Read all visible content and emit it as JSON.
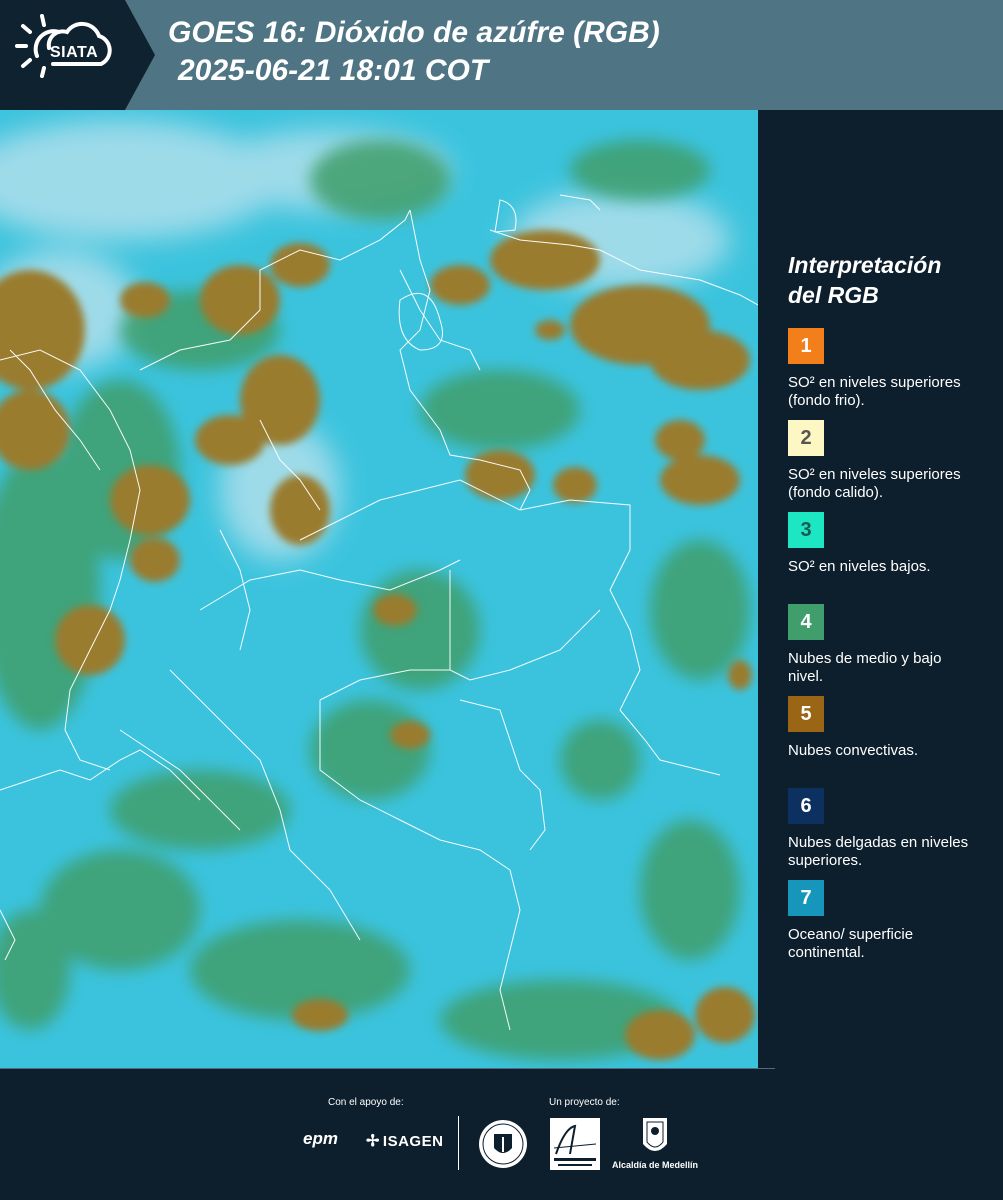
{
  "header": {
    "logo_text": "SIATA",
    "title_line1": "GOES 16: Dióxido de azúfre (RGB)",
    "title_line2": "2025-06-21 18:01 COT"
  },
  "map": {
    "background_color": "#3bc3dd"
  },
  "legend": {
    "title_line1": "Interpretación",
    "title_line2": "del RGB",
    "items": [
      {
        "number": "1",
        "color": "#f27f1a",
        "text_color": "#ffffff",
        "description": "SO² en niveles superiores (fondo frio)."
      },
      {
        "number": "2",
        "color": "#fdf7c4",
        "text_color": "#555555",
        "description": "SO² en niveles superiores (fondo calido)."
      },
      {
        "number": "3",
        "color": "#1de6c2",
        "text_color": "#1a5a52",
        "description": "SO² en niveles bajos."
      },
      {
        "number": "4",
        "color": "#3f9e6b",
        "text_color": "#ffffff",
        "description": "Nubes de medio y bajo nivel."
      },
      {
        "number": "5",
        "color": "#9a6514",
        "text_color": "#ffffff",
        "description": "Nubes convectivas."
      },
      {
        "number": "6",
        "color": "#0c3160",
        "text_color": "#ffffff",
        "description": "Nubes delgadas en niveles superiores."
      },
      {
        "number": "7",
        "color": "#1596ba",
        "text_color": "#ffffff",
        "description": "Oceano/ superficie continental."
      }
    ]
  },
  "footer": {
    "support_label": "Con el apoyo de:",
    "project_label": "Un proyecto de:",
    "sponsor1": "epm",
    "sponsor2": "ISAGEN",
    "partner3": "Alcaldía de Medellín"
  }
}
